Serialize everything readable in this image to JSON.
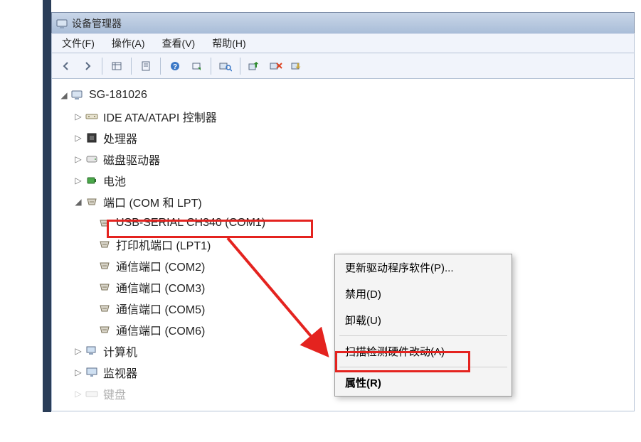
{
  "title": "设备管理器",
  "menu": {
    "file": "文件(F)",
    "action": "操作(A)",
    "view": "查看(V)",
    "help": "帮助(H)"
  },
  "root": "SG-181026",
  "nodes": {
    "ide": "IDE ATA/ATAPI 控制器",
    "cpu": "处理器",
    "disk": "磁盘驱动器",
    "battery": "电池",
    "ports": "端口 (COM 和 LPT)",
    "computer": "计算机",
    "monitor": "监视器",
    "keyboard": "键盘"
  },
  "port_children": [
    "USB-SERIAL CH340 (COM1)",
    "打印机端口 (LPT1)",
    "通信端口 (COM2)",
    "通信端口 (COM3)",
    "通信端口 (COM5)",
    "通信端口 (COM6)"
  ],
  "context_menu": {
    "update": "更新驱动程序软件(P)...",
    "disable": "禁用(D)",
    "uninstall": "卸载(U)",
    "scan": "扫描检测硬件改动(A)",
    "properties": "属性(R)"
  }
}
